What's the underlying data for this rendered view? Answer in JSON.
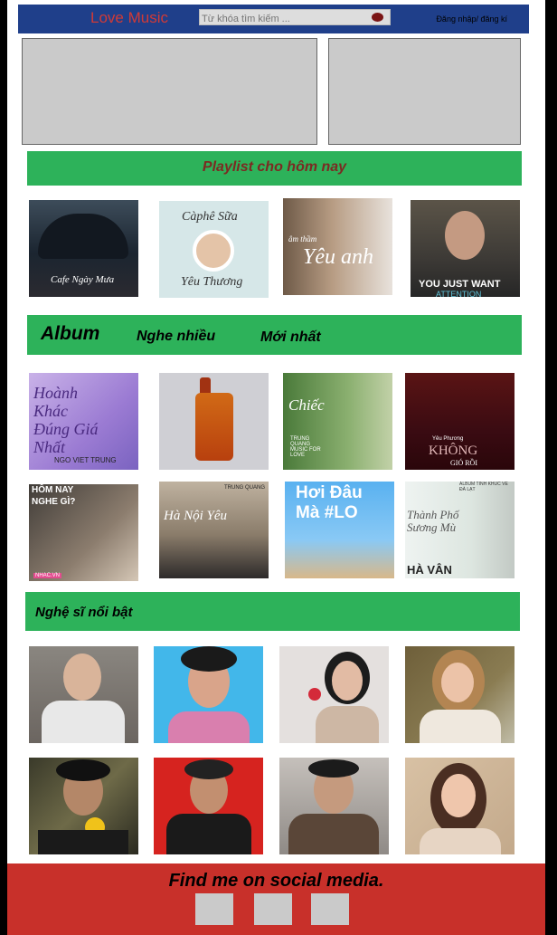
{
  "header": {
    "brand": "Love Music",
    "search_placeholder": "Từ khóa tìm kiếm ...",
    "login_label": "Đăng nhập/ đăng kí"
  },
  "playlist": {
    "title": "Playlist cho hôm nay",
    "items": [
      {
        "caption": "Cafe Ngày Mưa"
      },
      {
        "caption_top": "Càphê Sữa",
        "caption_bottom": "Yêu Thương"
      },
      {
        "caption_small": "âm thầm",
        "caption": "Yêu anh"
      },
      {
        "caption": "YOU JUST WANT",
        "caption_sub": "ATTENTION"
      }
    ]
  },
  "album_section": {
    "title": "Album",
    "tabs": [
      "Nghe nhiều",
      "Mới nhất"
    ],
    "row1": [
      {
        "caption": "Hoành Khác Đúng Giá Nhất",
        "caption_sub": "NGO VIET TRUNG"
      },
      {
        "caption": ""
      },
      {
        "caption": "Chiếc",
        "caption_sub": "TRUNG QUANG MUSIC FOR LOVE"
      },
      {
        "caption": "KHÔNG",
        "caption_top": "Yêu Phương",
        "caption_sub": "GIÓ RỒI"
      }
    ],
    "row2": [
      {
        "caption": "HÔM NAY NGHE GÌ?",
        "caption_sub": "NHAC.VN"
      },
      {
        "caption": "Hà Nội Yêu",
        "caption_sub": "TRUNG QUANG"
      },
      {
        "caption": "Hơi Đâu Mà #LO"
      },
      {
        "caption_small": "ALBUM TÌNH KHÚC VỀ ĐÀ LẠT",
        "caption": "Thành Phố Sương Mù",
        "caption_sub": "HÀ VÂN"
      }
    ]
  },
  "artists": {
    "title": "Nghệ sĩ nổi bật"
  },
  "footer": {
    "text": "Find me on social media."
  }
}
